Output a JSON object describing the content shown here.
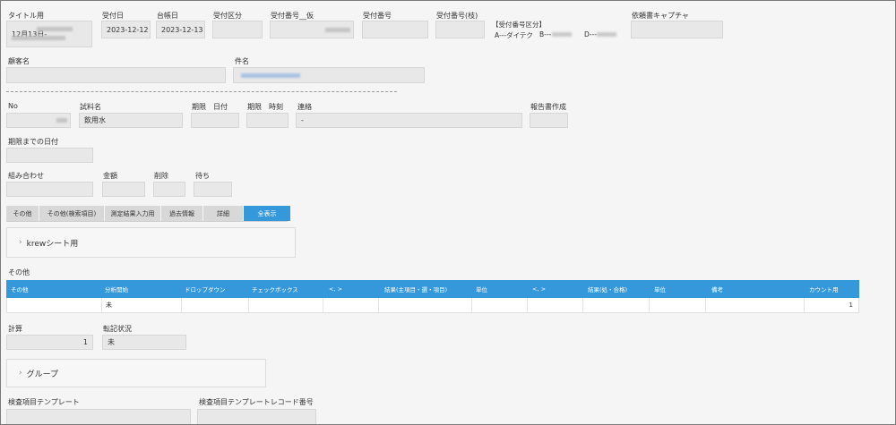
{
  "header": {
    "title_label": "タイトル用",
    "title_line1": "12月13日-",
    "title_line2": "",
    "reception_date_label": "受付日",
    "reception_date": "2023-12-12",
    "ledger_date_label": "台帳日",
    "ledger_date": "2023-12-13",
    "reception_type_label": "受付区分",
    "reception_number_label": "受付番号__仮",
    "reception_no_label": "受付番号",
    "reception_no_branch_label": "受付番号(枝)",
    "category_title": "【受付番号区分】",
    "category_a": "A---ダイテク",
    "category_b": "B---",
    "category_d": "D---",
    "capture_label": "依頼書キャプチャ"
  },
  "customer": {
    "customer_label": "顧客名",
    "subject_label": "件名"
  },
  "sample": {
    "no_label": "No",
    "name_label": "試料名",
    "name_value": "飲用水",
    "deadline_date_label": "期限　日付",
    "deadline_time_label": "期限　時刻",
    "contact_label": "連絡",
    "contact_value": "-",
    "report_label": "報告書作成",
    "days_label": "期限までの日付",
    "combo_label": "組み合わせ",
    "price_label": "金額",
    "delete_label": "削除",
    "wait_label": "待ち"
  },
  "tabs": [
    {
      "label": "その他"
    },
    {
      "label": "その他(検索項目)"
    },
    {
      "label": "測定結果入力用"
    },
    {
      "label": "過去情報"
    },
    {
      "label": "詳細"
    },
    {
      "label": "全表示"
    }
  ],
  "krew_group_label": "krewシート用",
  "other_section_title": "その他",
  "table": {
    "headers": [
      "その他",
      "分析開始",
      "ドロップダウン",
      "チェックボックス",
      "<, >",
      "結果(主項目・選・項目)",
      "単位",
      "<, >",
      "結果(処・合格)",
      "単位",
      "備考",
      "カウント用"
    ],
    "row": {
      "start": "未",
      "count": "1"
    }
  },
  "calc": {
    "calc_label": "計算",
    "calc_value": "1",
    "record_label": "転記状況",
    "record_value": "未"
  },
  "group_label": "グループ",
  "template": {
    "template_label": "検査項目テンプレート",
    "record_no_label": "検査項目テンプレートレコード番号"
  }
}
